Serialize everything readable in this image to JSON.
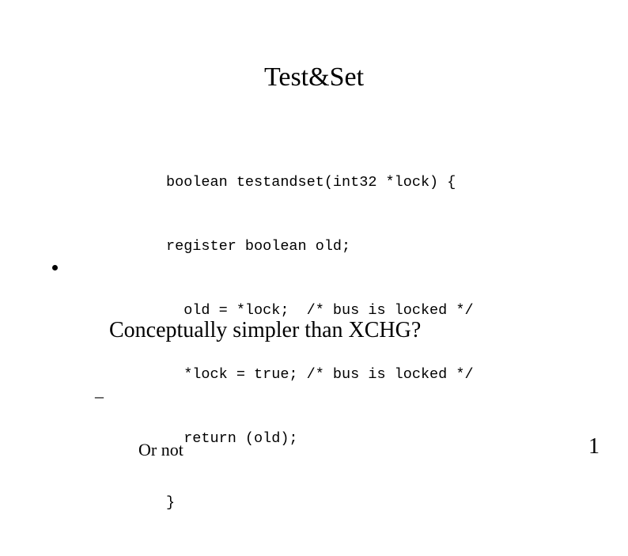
{
  "slide": {
    "title": "Test&Set",
    "page_number": "1",
    "background_color": "#ffffff",
    "text_color": "#000000"
  },
  "code": {
    "lines": [
      "boolean testandset(int32 *lock) {",
      "register boolean old;",
      "  old = *lock;  /* bus is locked */",
      "  *lock = true; /* bus is locked */",
      "  return (old);",
      "}"
    ]
  },
  "bullets": [
    {
      "marker": "bullet-dot",
      "text": "Conceptually simpler than XCHG?",
      "sub": [
        {
          "marker": "–",
          "text": "Or not"
        }
      ]
    }
  ]
}
